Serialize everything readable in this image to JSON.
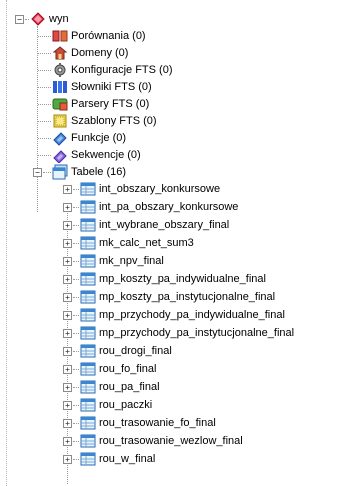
{
  "root": {
    "label": "wyn",
    "expander": "−",
    "icon": "database-icon"
  },
  "categories": [
    {
      "label": "Porównania (0)",
      "icon": "comparison-icon"
    },
    {
      "label": "Domeny (0)",
      "icon": "domain-icon"
    },
    {
      "label": "Konfiguracje FTS (0)",
      "icon": "config-icon"
    },
    {
      "label": "Słowniki FTS (0)",
      "icon": "dictionary-icon"
    },
    {
      "label": "Parsery FTS (0)",
      "icon": "parser-icon"
    },
    {
      "label": "Szablony FTS (0)",
      "icon": "template-icon"
    },
    {
      "label": "Funkcje (0)",
      "icon": "function-icon"
    },
    {
      "label": "Sekwencje (0)",
      "icon": "sequence-icon"
    }
  ],
  "tables_node": {
    "label": "Tabele (16)",
    "expander": "−",
    "icon": "tables-icon"
  },
  "tables": [
    {
      "label": "int_obszary_konkursowe",
      "expander": "+"
    },
    {
      "label": "int_pa_obszary_konkursowe",
      "expander": "+"
    },
    {
      "label": "int_wybrane_obszary_final",
      "expander": "+"
    },
    {
      "label": "mk_calc_net_sum3",
      "expander": "+"
    },
    {
      "label": "mk_npv_final",
      "expander": "+"
    },
    {
      "label": "mp_koszty_pa_indywidualne_final",
      "expander": "+"
    },
    {
      "label": "mp_koszty_pa_instytucjonalne_final",
      "expander": "+"
    },
    {
      "label": "mp_przychody_pa_indywidualne_final",
      "expander": "+"
    },
    {
      "label": "mp_przychody_pa_instytucjonalne_final",
      "expander": "+"
    },
    {
      "label": "rou_drogi_final",
      "expander": "+"
    },
    {
      "label": "rou_fo_final",
      "expander": "+"
    },
    {
      "label": "rou_pa_final",
      "expander": "+"
    },
    {
      "label": "rou_paczki",
      "expander": "+"
    },
    {
      "label": "rou_trasowanie_fo_final",
      "expander": "+"
    },
    {
      "label": "rou_trasowanie_wezlow_final",
      "expander": "+"
    },
    {
      "label": "rou_w_final",
      "expander": "+"
    }
  ]
}
